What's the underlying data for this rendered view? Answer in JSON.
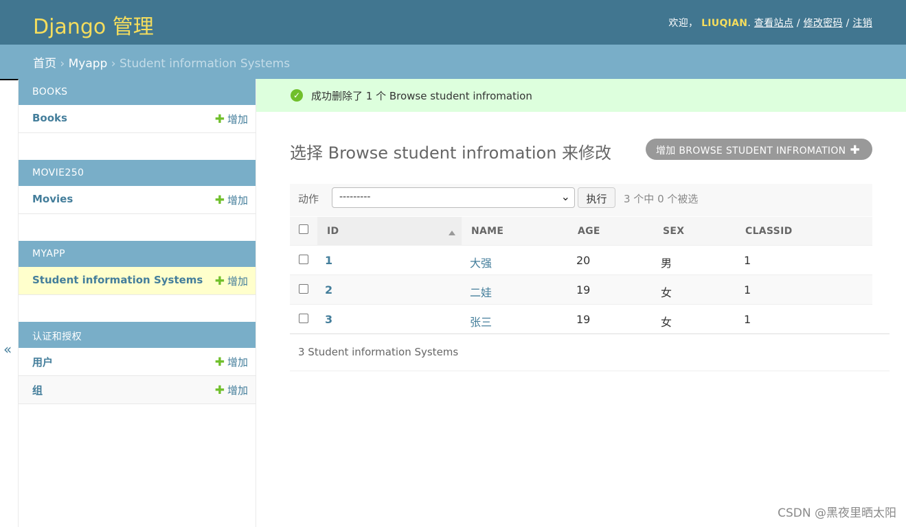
{
  "header": {
    "brand": "Django 管理",
    "welcome": "欢迎，",
    "username": "LIUQIAN",
    "period": ".",
    "view_site": "查看站点",
    "slash1": "/",
    "change_password": "修改密码",
    "slash2": "/",
    "logout": "注销"
  },
  "breadcrumbs": {
    "home": "首页",
    "sep1": "›",
    "app": "Myapp",
    "sep2": "›",
    "current": "Student information Systems"
  },
  "nav_toggle": "«",
  "sidebar": {
    "add_label": "增加",
    "modules": [
      {
        "caption": "BOOKS",
        "rows": [
          "Books"
        ]
      },
      {
        "caption": "MOVIE250",
        "rows": [
          "Movies"
        ]
      },
      {
        "caption": "MYAPP",
        "rows": [
          "Student information Systems"
        ]
      },
      {
        "caption": "认证和授权",
        "rows": [
          "用户",
          "组"
        ]
      }
    ]
  },
  "message": "成功删除了 1 个 Browse student infromation",
  "page_title": "选择 Browse student infromation 来修改",
  "add_button": "增加 BROWSE STUDENT INFROMATION",
  "actions": {
    "label": "动作",
    "selected": "---------",
    "go": "执行",
    "counter": "3 个中 0 个被选"
  },
  "table": {
    "columns": [
      "ID",
      "NAME",
      "AGE",
      "SEX",
      "CLASSID"
    ],
    "rows": [
      {
        "id": "1",
        "name": "大强",
        "age": "20",
        "sex": "男",
        "classid": "1"
      },
      {
        "id": "2",
        "name": "二娃",
        "age": "19",
        "sex": "女",
        "classid": "1"
      },
      {
        "id": "3",
        "name": "张三",
        "age": "19",
        "sex": "女",
        "classid": "1"
      }
    ]
  },
  "paginator": "3 Student information Systems",
  "watermark": "CSDN @黑夜里晒太阳",
  "colors": {
    "header_bg": "#417690",
    "brand": "#f5dd5d",
    "breadcrumb_bg": "#79aec8",
    "link": "#447e9b",
    "success_bg": "#dfd",
    "success_icon": "#70bf2b",
    "current_row": "#ffffcc"
  },
  "icons": [
    "check-circle-icon",
    "plus-icon",
    "sort-ascending-icon",
    "chevron-down-icon",
    "collapse-nav-icon"
  ]
}
